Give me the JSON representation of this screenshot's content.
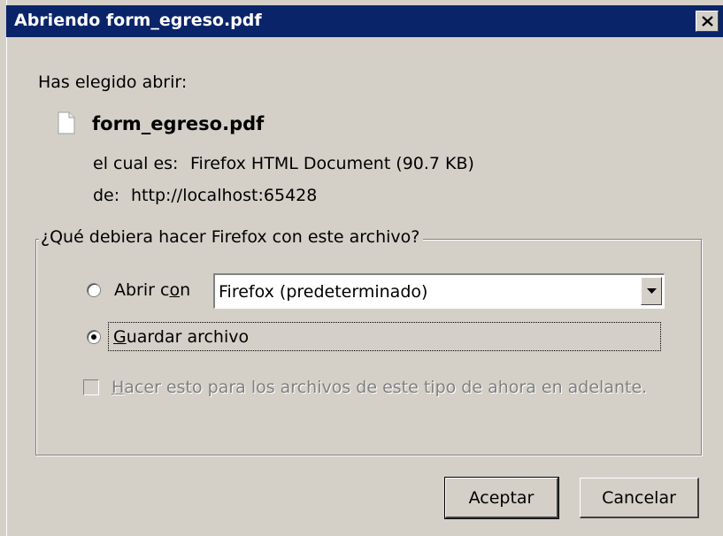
{
  "dialog": {
    "title": "Abriendo form_egreso.pdf",
    "close_glyph": "✕",
    "intro": "Has elegido abrir:",
    "file": {
      "icon": "document-icon",
      "name": "form_egreso.pdf",
      "type_label": "el cual es:",
      "type_value": "Firefox HTML Document (90.7 KB)",
      "from_label": "de:",
      "from_value": "http://localhost:65428"
    },
    "group": {
      "legend": "¿Qué debiera hacer Firefox con este archivo?",
      "open_with": {
        "label_pre": "Abrir c",
        "label_acc": "o",
        "label_post": "n",
        "selected": false
      },
      "app_select": {
        "value": "Firefox (predeterminado)"
      },
      "save_file": {
        "label_acc": "G",
        "label_post": "uardar archivo",
        "selected": true
      },
      "remember": {
        "label_acc": "H",
        "label_post": "acer esto para los archivos de este tipo de ahora en adelante.",
        "checked": false,
        "disabled": true
      }
    },
    "buttons": {
      "ok": "Aceptar",
      "cancel": "Cancelar"
    }
  }
}
